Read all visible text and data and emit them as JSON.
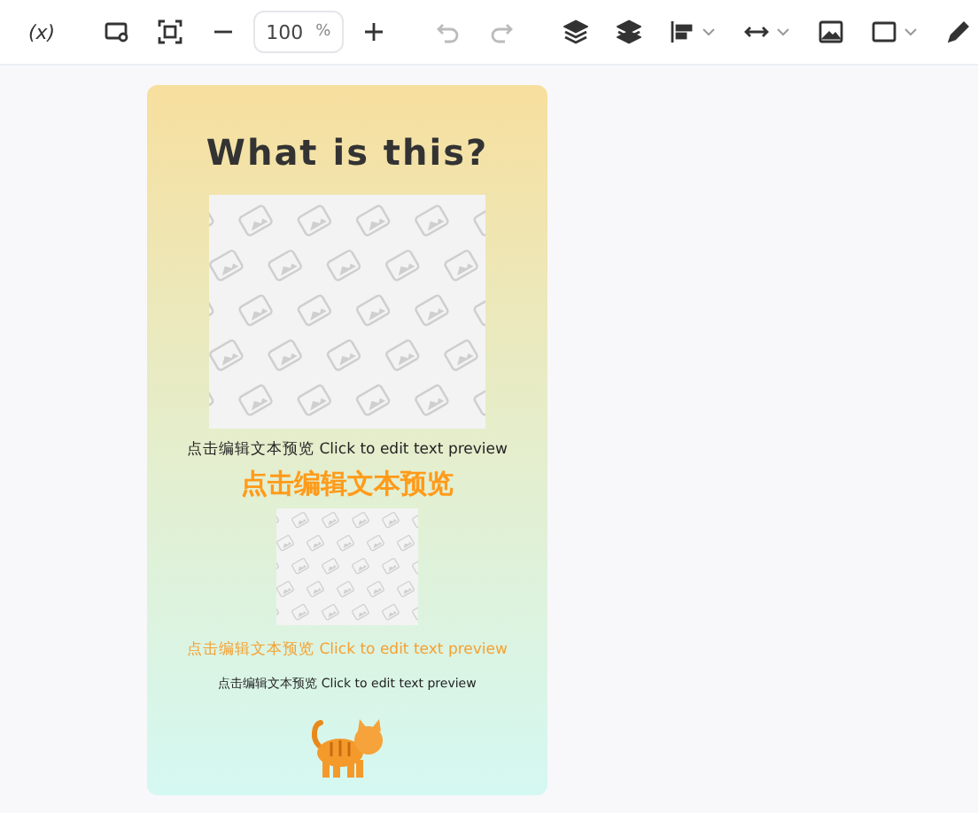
{
  "toolbar": {
    "items": [
      {
        "kind": "variable",
        "label": "(x)",
        "disabled": false
      },
      {
        "kind": "sep"
      },
      {
        "kind": "screen",
        "disabled": false
      },
      {
        "kind": "fit",
        "disabled": false
      },
      {
        "kind": "minus",
        "disabled": false
      },
      {
        "kind": "zoom",
        "value": "100",
        "unit": "%"
      },
      {
        "kind": "plus",
        "disabled": false
      },
      {
        "kind": "sep"
      },
      {
        "kind": "undo",
        "disabled": true
      },
      {
        "kind": "redo",
        "disabled": true
      },
      {
        "kind": "sep"
      },
      {
        "kind": "layer-up",
        "disabled": false
      },
      {
        "kind": "layer-down",
        "disabled": false
      },
      {
        "kind": "align",
        "disabled": false,
        "caret": true
      },
      {
        "kind": "width",
        "disabled": false,
        "caret": true
      },
      {
        "kind": "image",
        "disabled": false
      },
      {
        "kind": "rect",
        "disabled": false,
        "caret": true
      },
      {
        "kind": "pen",
        "disabled": false
      }
    ]
  },
  "card": {
    "blocks": [
      {
        "kind": "title",
        "text": "What is this?"
      },
      {
        "kind": "image"
      },
      {
        "kind": "text",
        "text": "点击编辑文本预览 Click to edit text preview"
      },
      {
        "kind": "heading",
        "text": "点击编辑文本预览"
      },
      {
        "kind": "thumb"
      },
      {
        "kind": "accent",
        "text": "点击编辑文本预览 Click to edit text preview"
      },
      {
        "kind": "small",
        "text": "点击编辑文本预览 Click to edit text preview"
      },
      {
        "kind": "cat"
      }
    ]
  }
}
